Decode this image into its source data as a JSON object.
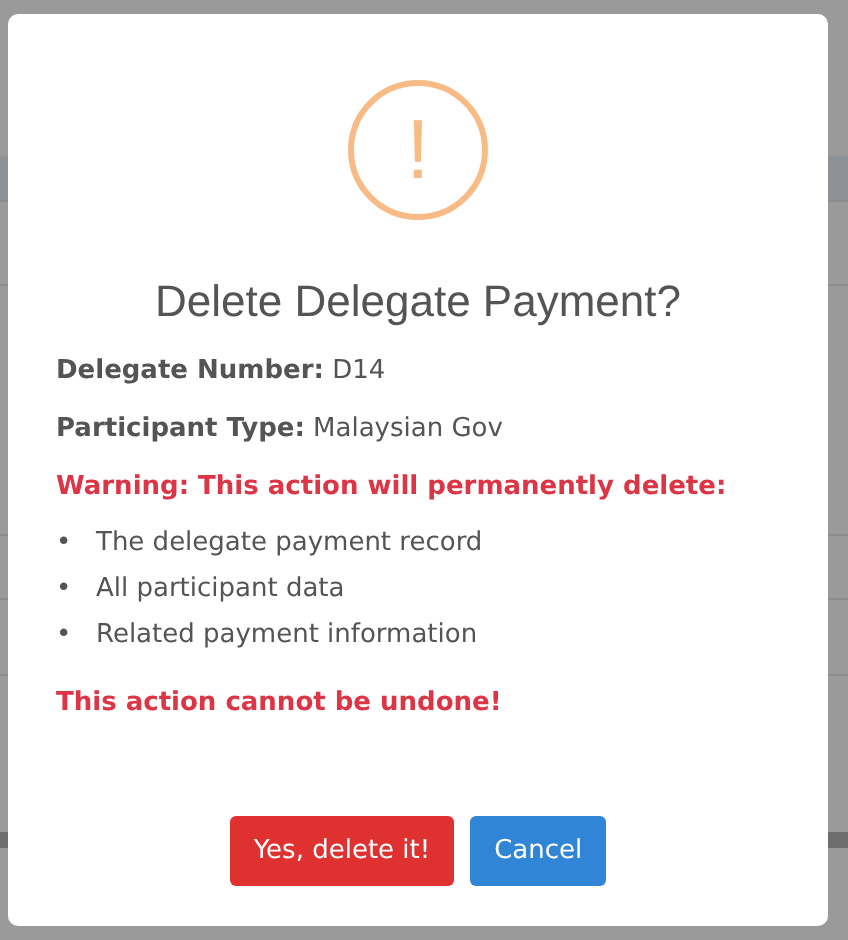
{
  "dialog": {
    "icon": "!",
    "title": "Delete Delegate Payment?",
    "fields": [
      {
        "label": "Delegate Number:",
        "value": "D14"
      },
      {
        "label": "Participant Type:",
        "value": "Malaysian Gov"
      }
    ],
    "warning": "Warning: This action will permanently delete:",
    "items": [
      {
        "bullet": "•",
        "text": "The delegate payment record"
      },
      {
        "bullet": "•",
        "text": "All participant data"
      },
      {
        "bullet": "•",
        "text": "Related payment information"
      }
    ],
    "note": "This action cannot be undone!",
    "buttons": [
      {
        "label": "Yes, delete it!",
        "kind": "danger"
      },
      {
        "label": "Cancel",
        "kind": "cancel"
      }
    ]
  }
}
